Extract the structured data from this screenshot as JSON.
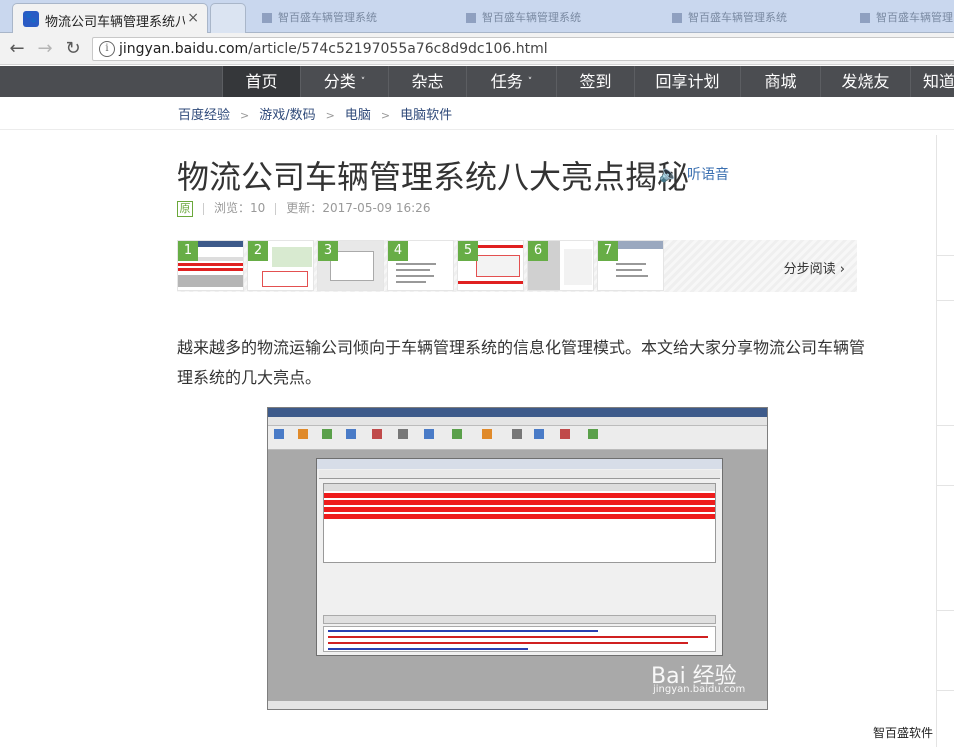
{
  "browser": {
    "active_tab_title": "物流公司车辆管理系统八",
    "background_tabs": [
      "智百盛车辆管理系统",
      "智百盛车辆管理系统",
      "智百盛车辆管理系统",
      "智百盛车辆管理系统"
    ],
    "url_host": "jingyan.baidu.com",
    "url_path": "/article/574c52197055a76c8d9dc106.html",
    "close_glyph": "×",
    "back_glyph": "←",
    "forward_glyph": "→",
    "reload_glyph": "↻",
    "info_glyph": "i"
  },
  "site_nav": {
    "items": [
      "首页",
      "分类",
      "杂志",
      "任务",
      "签到",
      "回享计划",
      "商城",
      "发烧友",
      "知道"
    ],
    "active": "首页",
    "caret_glyph": "˅"
  },
  "breadcrumb": {
    "items": [
      "百度经验",
      "游戏/数码",
      "电脑",
      "电脑软件"
    ],
    "sep_glyph": ">"
  },
  "article": {
    "title": "物流公司车辆管理系统八大亮点揭秘",
    "listen_label": "听语音",
    "speaker_glyph": "🔈",
    "badge": "原",
    "views_label": "浏览：",
    "views": "10",
    "updated_label": "更新：",
    "updated": "2017-05-09 16:26",
    "steps": [
      "1",
      "2",
      "3",
      "4",
      "5",
      "6",
      "7"
    ],
    "step_read_label": "分步阅读",
    "step_read_arrow": "›",
    "intro": "越来越多的物流运输公司倾向于车辆管理系统的信息化管理模式。本文给大家分享物流公司车辆管理系统的几大亮点。",
    "watermark": "Bai 经验",
    "watermark_sub": "jingyan.baidu.com"
  },
  "corner_text": "智百盛软件",
  "colors": {
    "site_nav_bg": "#4b4d51",
    "step_badge": "#67ad46",
    "link": "#2f4a7a",
    "grid_row_red": "#ee1c1c"
  }
}
